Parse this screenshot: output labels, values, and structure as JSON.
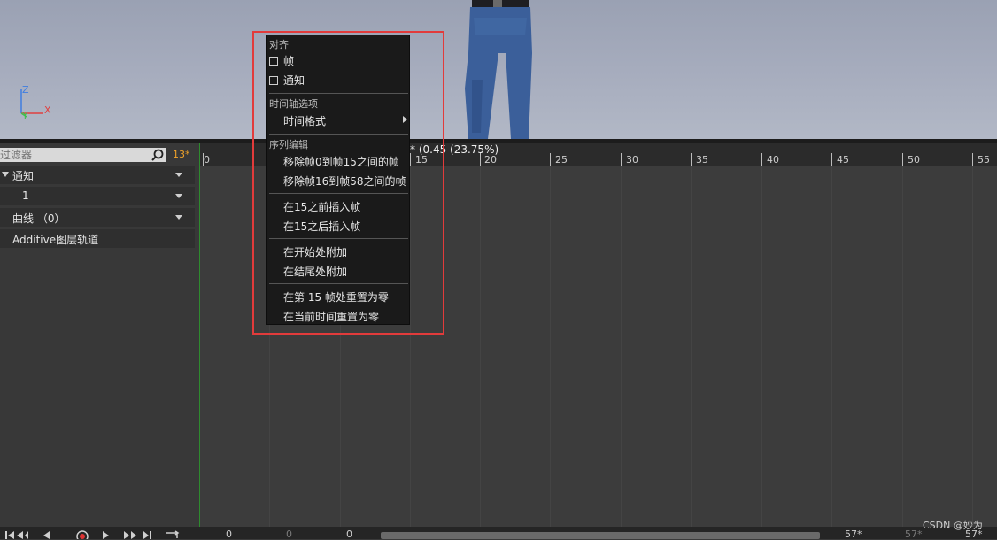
{
  "viewport": {
    "axes": {
      "z": "Z",
      "y": "Y",
      "x": "X"
    }
  },
  "left_panel": {
    "filter_placeholder": "过滤器",
    "frame_badge": "13*",
    "tracks": [
      {
        "label": "通知"
      },
      {
        "label": "1"
      },
      {
        "label": "曲线 （0）"
      },
      {
        "label": "Additive图层轨道"
      }
    ]
  },
  "ruler": {
    "ticks": [
      "0",
      "15",
      "20",
      "25",
      "30",
      "35",
      "40",
      "45",
      "50",
      "55"
    ]
  },
  "playhead": {
    "info": "* (0.45  (23.75%)"
  },
  "context_menu": {
    "section_align": "对齐",
    "check_frame": "帧",
    "check_notify": "通知",
    "section_timeline": "时间轴选项",
    "time_format": "时间格式",
    "section_sequence": "序列编辑",
    "remove_0_15": "移除帧0到帧15之间的帧",
    "remove_16_58": "移除帧16到帧58之间的帧",
    "insert_before": "在15之前插入帧",
    "insert_after": "在15之后插入帧",
    "append_start": "在开始处附加",
    "append_end": "在结尾处附加",
    "reset_at_15": "在第 15 帧处重置为零",
    "reset_current": "在当前时间重置为零"
  },
  "bottom_bar": {
    "n1": "0",
    "n2": "0",
    "n3": "0",
    "n4": "57*",
    "n5": "57*",
    "n6": "57*"
  },
  "watermark": "CSDN @妙为",
  "colors": {
    "accent_orange": "#f0a32a",
    "highlight_red": "#e23b3b",
    "menu_bg": "#1a1a1a"
  }
}
